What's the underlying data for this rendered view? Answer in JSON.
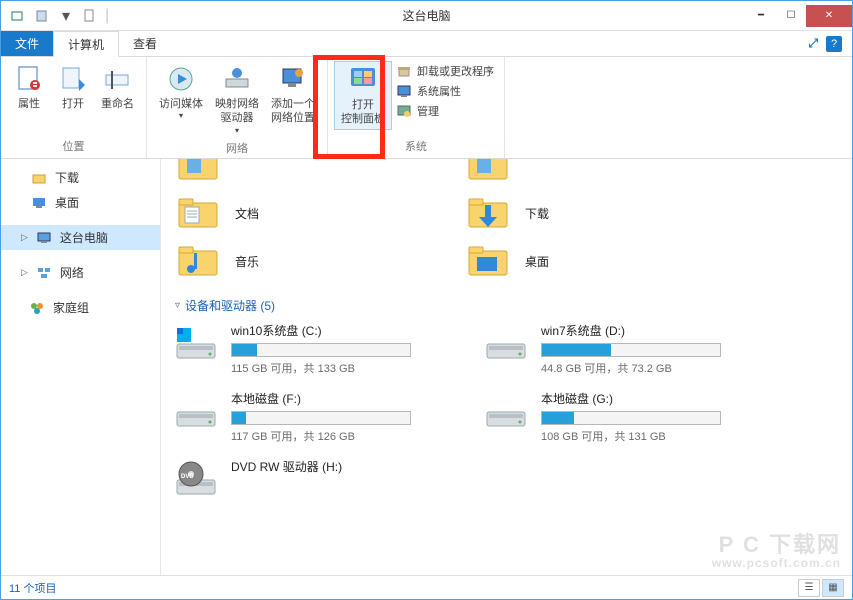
{
  "window": {
    "title": "这台电脑"
  },
  "tabs": {
    "file": "文件",
    "computer": "计算机",
    "view": "查看"
  },
  "ribbon": {
    "location": {
      "label": "位置",
      "properties": "属性",
      "open": "打开",
      "rename": "重命名"
    },
    "network": {
      "label": "网络",
      "access_media": "访问媒体",
      "map_drive_l1": "映射网络",
      "map_drive_l2": "驱动器",
      "add_loc_l1": "添加一个",
      "add_loc_l2": "网络位置"
    },
    "system": {
      "label": "系统",
      "open_cp_l1": "打开",
      "open_cp_l2": "控制面板",
      "uninstall": "卸载或更改程序",
      "sys_props": "系统属性",
      "manage": "管理"
    }
  },
  "nav": {
    "downloads": "下载",
    "desktop": "桌面",
    "this_pc": "这台电脑",
    "network": "网络",
    "homegroup": "家庭组"
  },
  "folders": {
    "partial1": "",
    "partial2": "",
    "documents": "文档",
    "downloads": "下载",
    "music": "音乐",
    "desktop": "桌面"
  },
  "devices": {
    "header": "设备和驱动器 (5)",
    "items": [
      {
        "name": "win10系统盘 (C:)",
        "sub": "115 GB 可用，共 133 GB",
        "fill": 14
      },
      {
        "name": "win7系统盘 (D:)",
        "sub": "44.8 GB 可用，共 73.2 GB",
        "fill": 39
      },
      {
        "name": "本地磁盘 (F:)",
        "sub": "117 GB 可用，共 126 GB",
        "fill": 8
      },
      {
        "name": "本地磁盘 (G:)",
        "sub": "108 GB 可用，共 131 GB",
        "fill": 18
      }
    ],
    "dvd": "DVD RW 驱动器 (H:)"
  },
  "status": {
    "items": "11 个项目"
  },
  "watermark": {
    "main": "P C 下载网",
    "sub": "www.pcsoft.com.cn"
  }
}
